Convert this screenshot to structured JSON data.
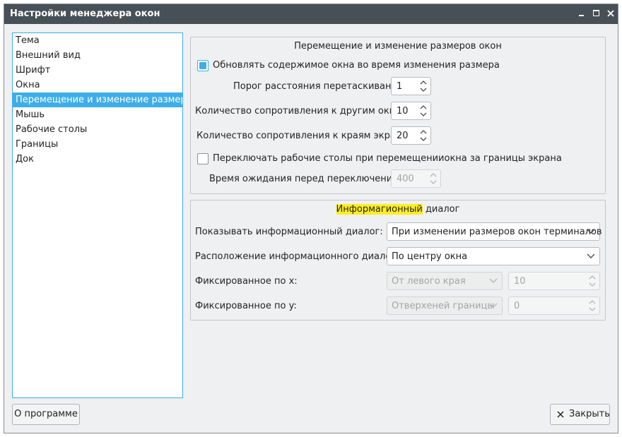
{
  "window": {
    "title": "Настройки менеджера окон"
  },
  "sidebar": {
    "items": [
      {
        "label": "Тема"
      },
      {
        "label": "Внешний вид"
      },
      {
        "label": "Шрифт"
      },
      {
        "label": "Окна"
      },
      {
        "label": "Перемещение и изменение размера",
        "selected": true
      },
      {
        "label": "Мышь"
      },
      {
        "label": "Рабочие столы"
      },
      {
        "label": "Границы"
      },
      {
        "label": "Док"
      }
    ]
  },
  "move_resize": {
    "title": "Перемещение и изменение размеров окон",
    "update_contents": {
      "label": "Обновлять содержимое окна во время изменения размера",
      "checked": true
    },
    "drag_threshold": {
      "label": "Порог расстояния перетаскивания:",
      "value": "1"
    },
    "resist_windows": {
      "label": "Количество сопротивления к другим окнам:",
      "value": "10"
    },
    "resist_edges": {
      "label": "Количество сопротивления к краям экрана:",
      "value": "20"
    },
    "switch_desktops": {
      "label": "Переключать рабочие столы при перемещенииокна за границы экрана",
      "checked": false
    },
    "switch_delay": {
      "label": "Время ожидания перед переключением:",
      "value": "400"
    }
  },
  "info_dialog": {
    "title_highlight": "Информагионный",
    "title_rest": " диалог",
    "show": {
      "label": "Показывать информационный диалог:",
      "value": "При изменении размеров окон терминалов"
    },
    "position": {
      "label": "Расположение информационного диалога:",
      "value": "По центру окна"
    },
    "fixed_x": {
      "label": "Фиксированное по x:",
      "mode": "От левого края",
      "value": "10"
    },
    "fixed_y": {
      "label": "Фиксированное по y:",
      "mode": "Отверхеней границы",
      "value": "0"
    }
  },
  "buttons": {
    "about": "О программе",
    "close": "Закрыть"
  },
  "colors": {
    "accent": "#3daee9",
    "titlebar": "#475057",
    "highlight": "#ffee1f"
  }
}
